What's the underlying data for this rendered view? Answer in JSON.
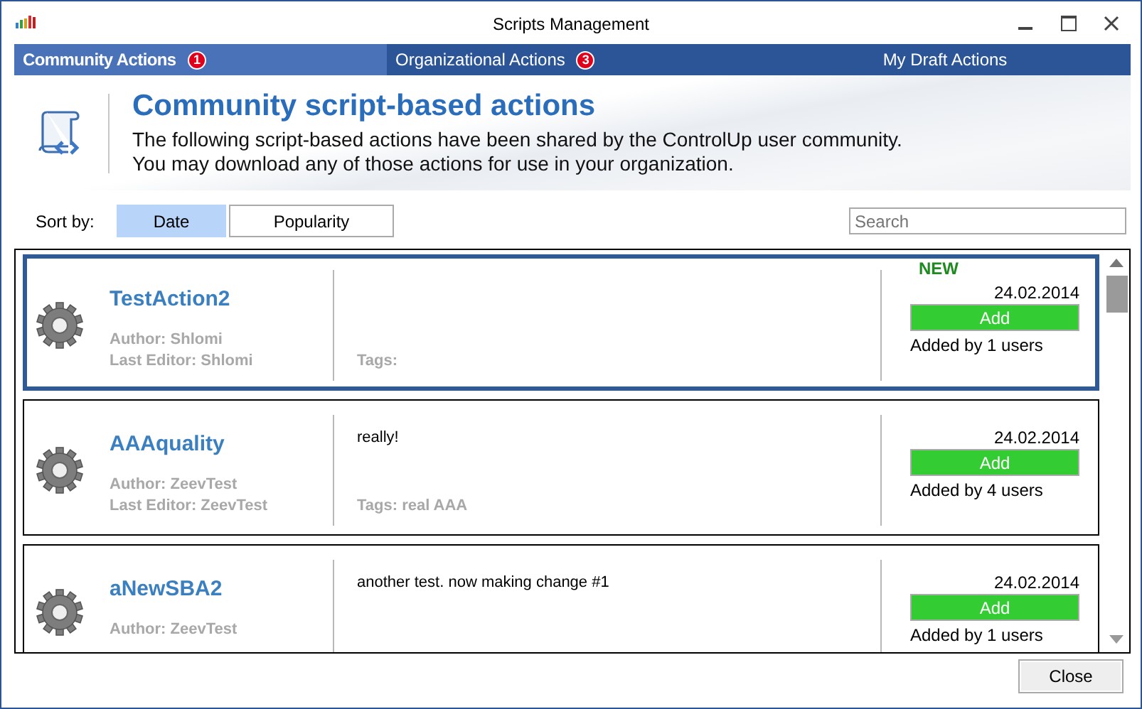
{
  "window": {
    "title": "Scripts Management"
  },
  "tabs": [
    {
      "label": "Community Actions",
      "badge": "1",
      "selected": true
    },
    {
      "label": "Organizational Actions",
      "badge": "3",
      "selected": false
    },
    {
      "label": "My Draft Actions",
      "selected": false
    }
  ],
  "header": {
    "title": "Community script-based actions",
    "description": [
      "The following script-based actions have been shared by the ControlUp user community.",
      "You may download any of those actions for use in your organization."
    ]
  },
  "sort": {
    "label": "Sort by:",
    "options": [
      {
        "label": "Date",
        "selected": true
      },
      {
        "label": "Popularity",
        "selected": false
      }
    ]
  },
  "search": {
    "placeholder": "Search"
  },
  "actions": [
    {
      "name": "TestAction2",
      "author": "Author: Shlomi",
      "last_editor": "Last Editor: Shlomi",
      "tags": "Tags:",
      "badge": "NEW",
      "date": "24.02.2014",
      "button": "Add",
      "added_by": "Added by 1 users",
      "selected": true
    },
    {
      "name": "AAAquality",
      "author": "Author: ZeevTest",
      "last_editor": "Last Editor: ZeevTest",
      "description": "really!",
      "tags": "Tags: real AAA",
      "date": "24.02.2014",
      "button": "Add",
      "added_by": "Added by 4 users",
      "selected": false
    },
    {
      "name": "aNewSBA2",
      "author": "Author: ZeevTest",
      "description": "another test. now making change #1",
      "date": "24.02.2014",
      "button": "Add",
      "added_by": "Added by 1 users",
      "selected": false
    }
  ],
  "footer": {
    "button": "Close"
  }
}
